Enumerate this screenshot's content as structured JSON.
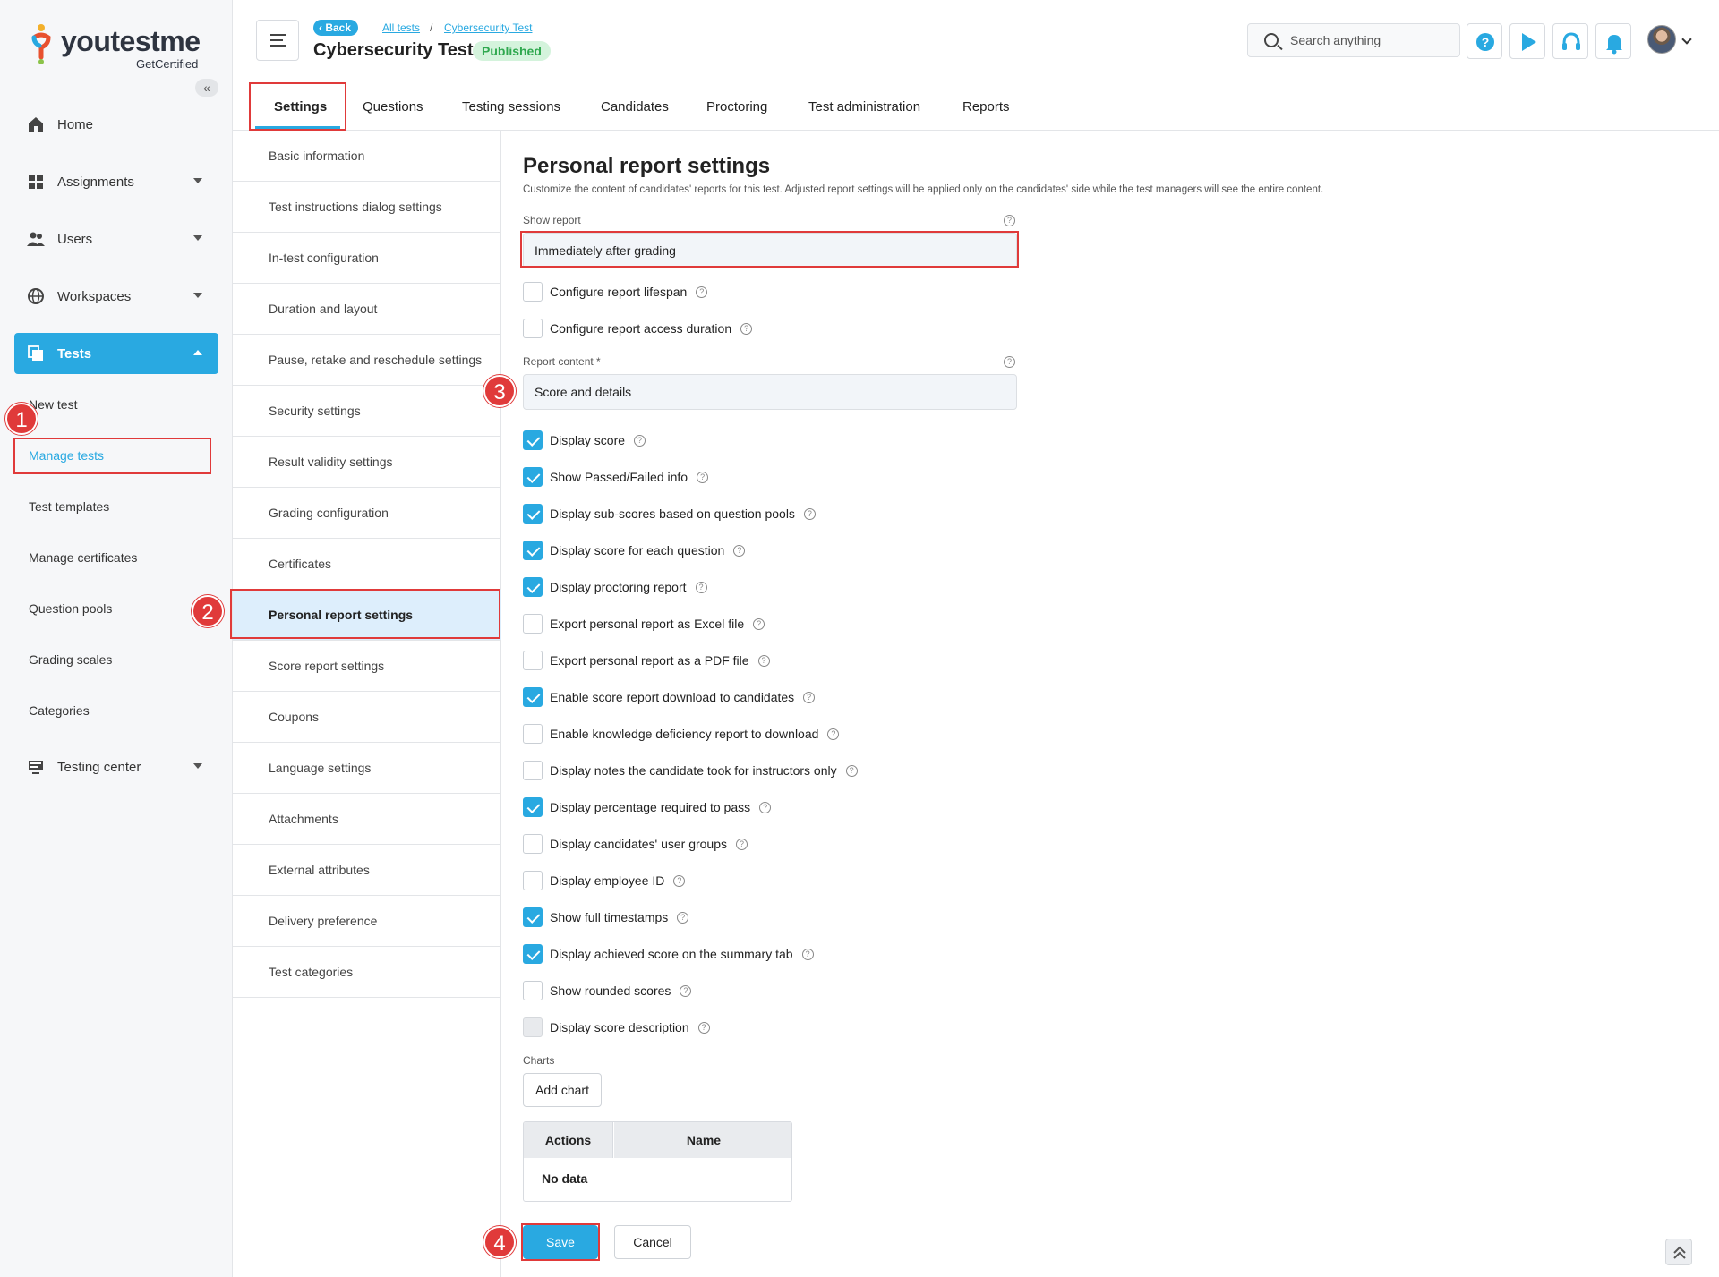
{
  "logo": {
    "name_a": "youtestme",
    "name_b": "",
    "tagline": "GetCertified"
  },
  "sidebar": {
    "collapse_icon": "«",
    "items": [
      {
        "label": "Home",
        "icon": "home-icon"
      },
      {
        "label": "Assignments",
        "icon": "assignments-icon"
      },
      {
        "label": "Users",
        "icon": "users-icon"
      },
      {
        "label": "Workspaces",
        "icon": "globe-icon"
      },
      {
        "label": "Tests",
        "icon": "tests-icon"
      },
      {
        "label": "Testing center",
        "icon": "monitor-icon"
      }
    ],
    "subitems": [
      "New test",
      "Manage tests",
      "Test templates",
      "Manage certificates",
      "Question pools",
      "Grading scales",
      "Categories"
    ]
  },
  "header": {
    "back_label": "Back",
    "breadcrumbs": [
      "All tests",
      "Cybersecurity Test"
    ],
    "crumb_sep": "/",
    "title": "Cybersecurity Test",
    "status": "Published",
    "search_placeholder": "Search anything"
  },
  "tabs": [
    "Settings",
    "Questions",
    "Testing sessions",
    "Candidates",
    "Proctoring",
    "Test administration",
    "Reports"
  ],
  "settings_menu": [
    "Basic information",
    "Test instructions dialog settings",
    "In-test configuration",
    "Duration and layout",
    "Pause, retake and reschedule settings",
    "Security settings",
    "Result validity settings",
    "Grading configuration",
    "Certificates",
    "Personal report settings",
    "Score report settings",
    "Coupons",
    "Language settings",
    "Attachments",
    "External attributes",
    "Delivery preference",
    "Test categories"
  ],
  "content": {
    "title": "Personal report settings",
    "description": "Customize the content of candidates' reports for this test. Adjusted report settings will be applied only on the candidates' side while the test managers will see the entire content.",
    "show_report_label": "Show report",
    "show_report_value": "Immediately after grading",
    "lifespan_label": "Configure report lifespan",
    "access_label": "Configure report access duration",
    "report_content_label": "Report content *",
    "report_content_value": "Score and details",
    "help_glyph": "?",
    "options": [
      {
        "label": "Display score",
        "checked": true
      },
      {
        "label": "Show Passed/Failed info",
        "checked": true
      },
      {
        "label": "Display sub-scores based on question pools",
        "checked": true
      },
      {
        "label": "Display score for each question",
        "checked": true
      },
      {
        "label": "Display proctoring report",
        "checked": true
      },
      {
        "label": "Export personal report as Excel file",
        "checked": false
      },
      {
        "label": "Export personal report as a PDF file",
        "checked": false
      },
      {
        "label": "Enable score report download to candidates",
        "checked": true
      },
      {
        "label": "Enable knowledge deficiency report to download",
        "checked": false
      },
      {
        "label": "Display notes the candidate took for instructors only",
        "checked": false
      },
      {
        "label": "Display percentage required to pass",
        "checked": true
      },
      {
        "label": "Display candidates' user groups",
        "checked": false
      },
      {
        "label": "Display employee ID",
        "checked": false
      },
      {
        "label": "Show full timestamps",
        "checked": true
      },
      {
        "label": "Display achieved score on the summary tab",
        "checked": true
      },
      {
        "label": "Show rounded scores",
        "checked": false
      },
      {
        "label": "Display score description",
        "checked": false,
        "disabled": true
      }
    ],
    "charts_label": "Charts",
    "add_chart_label": "Add chart",
    "table_headers": [
      "Actions",
      "Name"
    ],
    "no_data": "No data",
    "save_label": "Save",
    "cancel_label": "Cancel"
  },
  "annotations": [
    "1",
    "2",
    "3",
    "4"
  ],
  "colors": {
    "accent": "#29a9e1",
    "highlight": "#e03a3a",
    "published_bg": "#d4f3dc",
    "published_fg": "#2fa84f"
  }
}
